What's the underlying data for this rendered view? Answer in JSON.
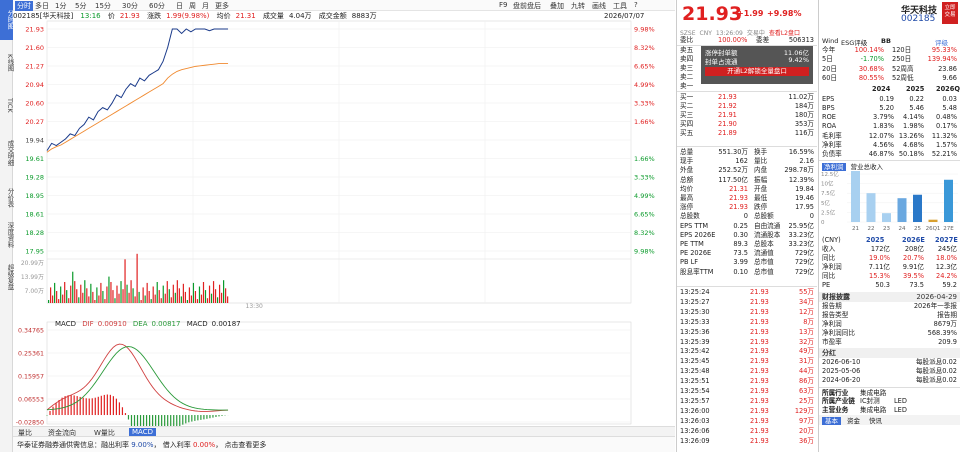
{
  "left_tabs": [
    "分时图",
    "K线图",
    "TICK",
    "成交明细",
    "分价表",
    "深度资料",
    "超级复盘"
  ],
  "timeframes": [
    "分时",
    "多日",
    "1分",
    "5分",
    "15分",
    "30分",
    "60分",
    "日",
    "周",
    "月",
    "更多"
  ],
  "top_right": {
    "f9": "F9",
    "items": [
      "盘前盘后",
      "叠加",
      "九转",
      "画线",
      "工具",
      "?"
    ]
  },
  "header": {
    "code_name": "002185[华天科技]",
    "time": "13:16",
    "price_label": "价",
    "price": "21.93",
    "chg_label": "涨跌",
    "chg": "1.99(9.98%)",
    "avg_label": "均价",
    "avg": "21.31",
    "vol_label": "成交量",
    "vol": "4.04万",
    "amt_label": "成交金额",
    "amt": "8883万",
    "date": "2026/07/07"
  },
  "y_left": [
    "21.93",
    "21.60",
    "21.27",
    "20.94",
    "20.60",
    "20.27",
    "19.94",
    "19.61",
    "19.28",
    "18.95",
    "18.61",
    "18.28",
    "17.95"
  ],
  "y_right": [
    "9.98%",
    "8.32%",
    "6.65%",
    "4.99%",
    "3.33%",
    "1.66%",
    "",
    "1.66%",
    "3.33%",
    "4.99%",
    "6.65%",
    "8.32%",
    "9.98%"
  ],
  "vol_axis": [
    "20.99万",
    "13.99万",
    "7.00万"
  ],
  "time_ticks": [
    "09:30",
    "10:30",
    "11:30/13:00",
    "14:00",
    "15:00"
  ],
  "time_partial": [
    "13:30"
  ],
  "macd_head": {
    "name": "MACD",
    "dif_label": "DIF",
    "dif": "0.00910",
    "dea_label": "DEA",
    "dea": "0.00817",
    "macd_label": "MACD",
    "macd": "0.00187"
  },
  "macd_axis": [
    "0.34765",
    "0.25361",
    "0.15957",
    "0.06553",
    "-0.02850"
  ],
  "bottom_tabs": [
    "量比",
    "资金流向",
    "W量比",
    "MACD"
  ],
  "ticker": {
    "text": "华泰证券融券通供需信息：融出利率",
    "rate1": "9.00%",
    "mid": "借入利率",
    "rate2": "0.00%",
    "tail": "点击查看更多"
  },
  "quote": {
    "price": "21.93",
    "chg": "+1.99",
    "pct": "+9.98%",
    "name": "华天科技",
    "code": "002185",
    "btn": "立即交易",
    "sub": [
      "SZSE",
      "CNY",
      "13:26:09",
      "交易中"
    ],
    "sub_link": "查看L2盘口"
  },
  "order_book": {
    "wb_label": "委比",
    "wb": "100.00%",
    "wc_label": "委差",
    "wc": "506313",
    "sells": [
      {
        "l": "卖五",
        "p": "",
        "v": ""
      },
      {
        "l": "卖四",
        "p": "",
        "v": ""
      },
      {
        "l": "卖三",
        "p": "",
        "v": ""
      },
      {
        "l": "卖二",
        "p": "",
        "v": ""
      },
      {
        "l": "卖一",
        "p": "",
        "v": ""
      }
    ],
    "popup": {
      "a": "涨停封单额",
      "av": "11.06亿",
      "b": "封单占流通",
      "bv": "9.42%",
      "link": "开通L2解锁全量盘口"
    },
    "buys": [
      {
        "l": "买一",
        "p": "21.93",
        "v": "11.02万"
      },
      {
        "l": "买二",
        "p": "21.92",
        "v": "184万"
      },
      {
        "l": "买三",
        "p": "21.91",
        "v": "180万"
      },
      {
        "l": "买四",
        "p": "21.90",
        "v": "353万"
      },
      {
        "l": "买五",
        "p": "21.89",
        "v": "116万"
      }
    ]
  },
  "stats": [
    [
      "总量",
      "551.30万",
      "换手",
      "16.59%"
    ],
    [
      "现手",
      "162",
      "量比",
      "2.16"
    ],
    [
      "外盘",
      "252.52万",
      "内盘",
      "298.78万"
    ],
    [
      "总额",
      "117.50亿",
      "振幅",
      "12.39%"
    ],
    [
      "均价",
      "21.31",
      "开盘",
      "19.84"
    ],
    [
      "最高",
      "21.93",
      "最低",
      "19.46"
    ],
    [
      "涨停",
      "21.93",
      "跌停",
      "17.95"
    ],
    [
      "总股数",
      "0",
      "总股额",
      "0"
    ],
    [
      "EPS TTM",
      "0.25",
      "自由流通",
      "25.95亿"
    ],
    [
      "EPS 2026E",
      "0.30",
      "流通股本",
      "33.23亿"
    ],
    [
      "PE TTM",
      "89.3",
      "总股本",
      "33.23亿"
    ],
    [
      "PE 2026E",
      "73.5",
      "流通值",
      "729亿"
    ],
    [
      "PB LF",
      "3.99",
      "总市值",
      "729亿"
    ],
    [
      "股息率TTM",
      "0.10",
      "总市值",
      "729亿"
    ]
  ],
  "trades": [
    [
      "13:25:24",
      "21.93",
      "55万"
    ],
    [
      "13:25:27",
      "21.93",
      "34万"
    ],
    [
      "13:25:30",
      "21.93",
      "12万"
    ],
    [
      "13:25:33",
      "21.93",
      "8万"
    ],
    [
      "13:25:36",
      "21.93",
      "13万"
    ],
    [
      "13:25:39",
      "21.93",
      "32万"
    ],
    [
      "13:25:42",
      "21.93",
      "49万"
    ],
    [
      "13:25:45",
      "21.93",
      "31万"
    ],
    [
      "13:25:48",
      "21.93",
      "44万"
    ],
    [
      "13:25:51",
      "21.93",
      "86万"
    ],
    [
      "13:25:54",
      "21.93",
      "63万"
    ],
    [
      "13:25:57",
      "21.93",
      "25万"
    ],
    [
      "13:26:00",
      "21.93",
      "129万"
    ],
    [
      "13:26:03",
      "21.93",
      "97万"
    ],
    [
      "13:26:06",
      "21.93",
      "20万"
    ],
    [
      "13:26:09",
      "21.93",
      "36万"
    ]
  ],
  "right": {
    "tabs": [
      "Wind",
      "ESG评级",
      "BB",
      "评级"
    ],
    "perf": [
      [
        "今年",
        "100.14%",
        "120日",
        "95.33%"
      ],
      [
        "5日",
        "-1.70%",
        "250日",
        "139.94%"
      ],
      [
        "20日",
        "30.68%",
        "52周高",
        "23.86"
      ],
      [
        "60日",
        "80.55%",
        "52周低",
        "9.66"
      ]
    ],
    "fin_head": [
      "",
      "2024",
      "2025",
      "2026Q1"
    ],
    "fin": [
      [
        "EPS",
        "0.19",
        "0.22",
        "0.03"
      ],
      [
        "BPS",
        "5.20",
        "5.46",
        "5.48"
      ],
      [
        "ROE",
        "3.79%",
        "4.14%",
        "0.48%"
      ],
      [
        "ROA",
        "1.83%",
        "1.98%",
        "0.17%"
      ],
      [
        "毛利率",
        "12.07%",
        "13.26%",
        "11.32%"
      ],
      [
        "净利率",
        "4.56%",
        "4.68%",
        "1.57%"
      ],
      [
        "负债率",
        "46.87%",
        "50.18%",
        "52.21%"
      ]
    ],
    "rev_tabs": [
      "净利润",
      "营业总收入"
    ],
    "rev_axis": [
      "12.5亿",
      "10亿",
      "7.5亿",
      "5亿",
      "2.5亿",
      "0"
    ],
    "rev_x": [
      "21",
      "22",
      "23",
      "24",
      "25",
      "26Q1",
      "27E"
    ],
    "rev_values": [
      14.2,
      7.5,
      2.3,
      6.2,
      7.1,
      0.6,
      11.0
    ],
    "fc_head": [
      "(CNY)",
      "2025",
      "2026E",
      "2027E"
    ],
    "fc": [
      [
        "收入",
        "172亿",
        "208亿",
        "245亿"
      ],
      [
        "同比",
        "19.0%",
        "20.7%",
        "18.0%"
      ],
      [
        "净利润",
        "7.11亿",
        "9.91亿",
        "12.3亿"
      ],
      [
        "同比",
        "15.3%",
        "39.5%",
        "24.2%"
      ],
      [
        "PE",
        "50.3",
        "73.5",
        "59.2"
      ]
    ],
    "report_title": "财报披露",
    "report_date": "2026-04-29",
    "report": [
      [
        "报告期",
        "2026年一季报"
      ],
      [
        "报告类型",
        "报告期"
      ],
      [
        "净利润",
        "8679万"
      ],
      [
        "净利润同比",
        "568.39%"
      ],
      [
        "市盈率",
        "209.9"
      ]
    ],
    "div_title": "分红",
    "div": [
      [
        "2026-06-10",
        "每股派息0.02"
      ],
      [
        "2025-05-06",
        "每股派息0.02"
      ],
      [
        "2024-06-20",
        "每股派息0.02"
      ]
    ],
    "ind": [
      [
        "所属行业",
        "集成电路"
      ],
      [
        "所属产业链",
        "IC封测",
        "LED"
      ],
      [
        "主营业务",
        "集成电路",
        "LED"
      ]
    ],
    "btabs": [
      "基本",
      "资金",
      "快讯"
    ]
  }
}
